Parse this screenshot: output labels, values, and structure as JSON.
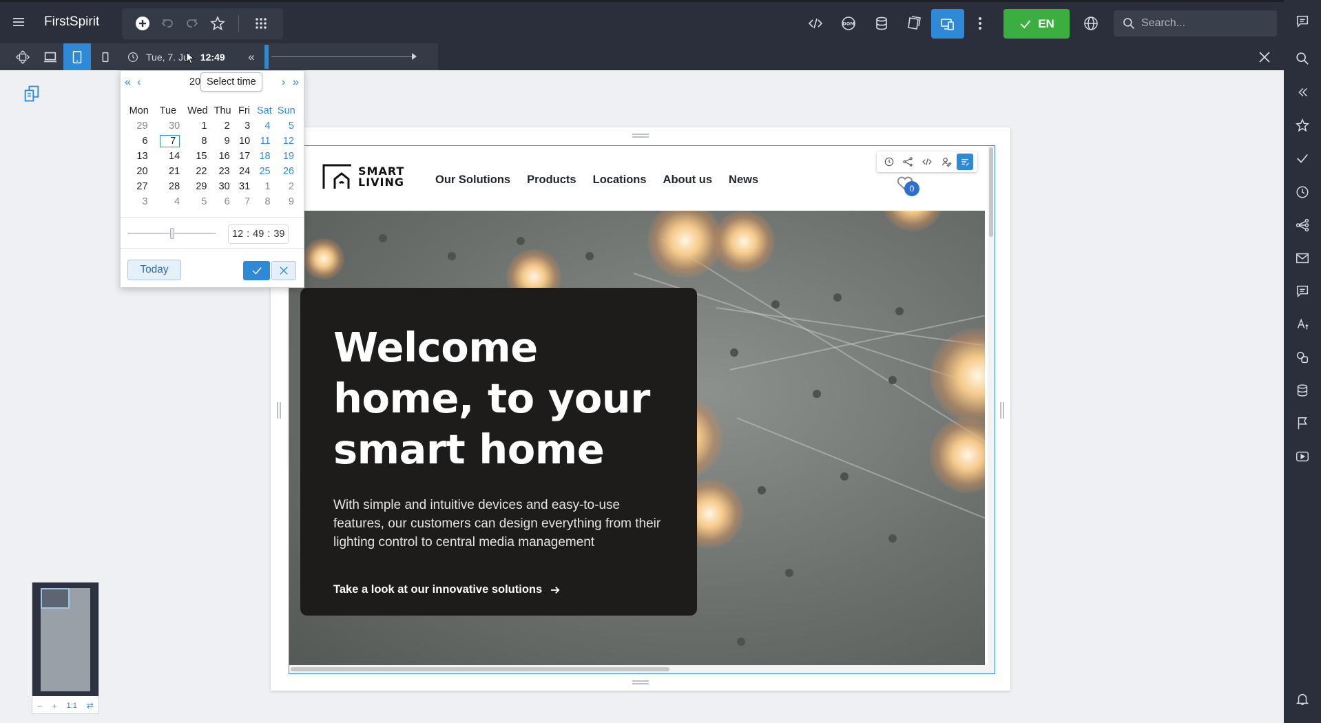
{
  "app": {
    "title": "FirstSpirit"
  },
  "topbar": {
    "search_placeholder": "Search...",
    "language_label": "EN",
    "colors": {
      "bar": "#2b2f3b",
      "accent": "#2e8ad6",
      "release_green": "#3cae3f"
    }
  },
  "timeline": {
    "date_text": "Tue, 7. Jul",
    "time_text": "12:49",
    "collapse_label": "«"
  },
  "calendar": {
    "nav": {
      "prev_year": "«",
      "prev_month": "‹",
      "next_month": "›",
      "next_year": "»"
    },
    "year_partial": "20",
    "tooltip": "Select time",
    "weekdays": [
      "Mon",
      "Tue",
      "Wed",
      "Thu",
      "Fri",
      "Sat",
      "Sun"
    ],
    "weeks": [
      [
        "29",
        "30",
        "1",
        "2",
        "3",
        "4",
        "5"
      ],
      [
        "6",
        "7",
        "8",
        "9",
        "10",
        "11",
        "12"
      ],
      [
        "13",
        "14",
        "15",
        "16",
        "17",
        "18",
        "19"
      ],
      [
        "20",
        "21",
        "22",
        "23",
        "24",
        "25",
        "26"
      ],
      [
        "27",
        "28",
        "29",
        "30",
        "31",
        "1",
        "2"
      ],
      [
        "3",
        "4",
        "5",
        "6",
        "7",
        "8",
        "9"
      ]
    ],
    "selected_day": "7",
    "time": {
      "hours": "12",
      "minutes": "49",
      "seconds": "39",
      "separator": ":"
    },
    "today_label": "Today"
  },
  "site": {
    "logo_line1": "SMART",
    "logo_line2": "LIVING",
    "nav": [
      "Our Solutions",
      "Products",
      "Locations",
      "About us",
      "News"
    ],
    "favorites_count": "0",
    "hero": {
      "title": "Welcome home, to your smart home",
      "text": "With simple and intuitive devices and easy-to-use features, our customers can design everything from their lighting control to central media management",
      "cta": "Take a look at our innovative solutions"
    }
  },
  "minimap": {
    "zoom_out": "−",
    "zoom_in": "+",
    "ratio": "1:1"
  }
}
